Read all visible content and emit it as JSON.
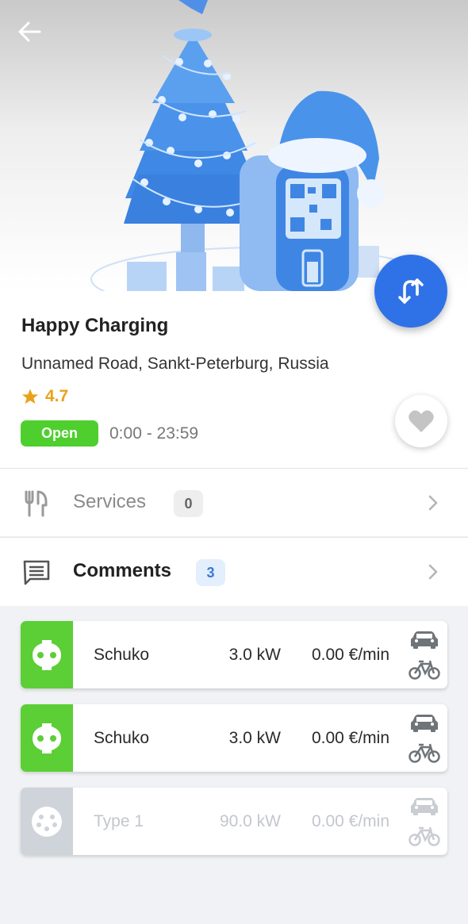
{
  "station": {
    "name": "Happy Charging",
    "address": "Unnamed Road, Sankt-Peterburg, Russia",
    "rating": "4.7",
    "status": "Open",
    "hours": "0:00 - 23:59"
  },
  "rows": [
    {
      "label": "Services",
      "count": "0",
      "icon": "utensils-icon"
    },
    {
      "label": "Comments",
      "count": "3",
      "icon": "comment-icon"
    }
  ],
  "connectors": [
    {
      "name": "Schuko",
      "power": "3.0 kW",
      "price": "0.00 €/min",
      "available": true
    },
    {
      "name": "Schuko",
      "power": "3.0 kW",
      "price": "0.00 €/min",
      "available": true
    },
    {
      "name": "Type 1",
      "power": "90.0 kW",
      "price": "0.00 €/min",
      "available": false
    }
  ],
  "colors": {
    "accent": "#2f72e8",
    "open": "#4fcf2e",
    "rating": "#e8a21a",
    "available": "#5bcf35",
    "unavailable": "#cfd3da"
  }
}
